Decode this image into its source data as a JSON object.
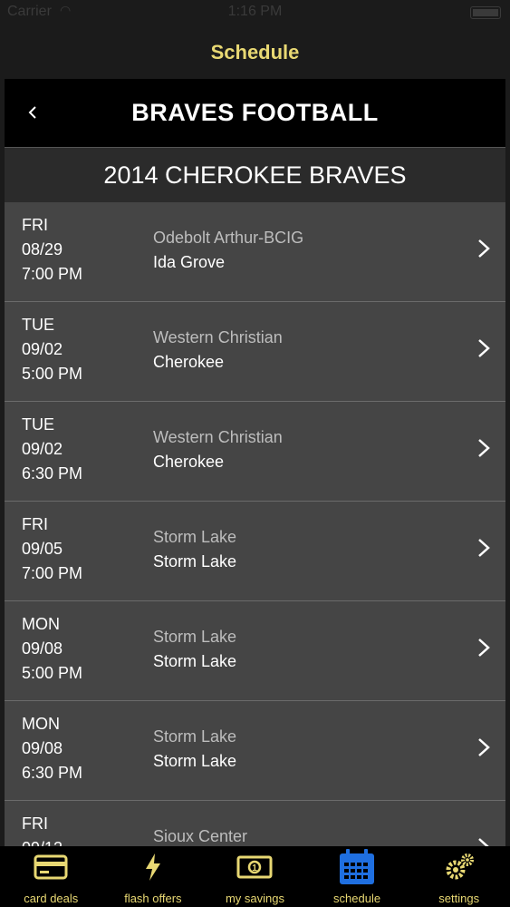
{
  "status_bar": {
    "carrier": "Carrier",
    "time": "1:16 PM"
  },
  "nav": {
    "title": "Schedule"
  },
  "team": {
    "title": "BRAVES FOOTBALL"
  },
  "season": {
    "title": "2014 CHEROKEE BRAVES"
  },
  "games": [
    {
      "day": "FRI",
      "date": "08/29",
      "time": "7:00 PM",
      "opponent": "Odebolt Arthur-BCIG",
      "location": "Ida Grove"
    },
    {
      "day": "TUE",
      "date": "09/02",
      "time": "5:00 PM",
      "opponent": "Western Christian",
      "location": "Cherokee"
    },
    {
      "day": "TUE",
      "date": "09/02",
      "time": "6:30 PM",
      "opponent": "Western Christian",
      "location": "Cherokee"
    },
    {
      "day": "FRI",
      "date": "09/05",
      "time": "7:00 PM",
      "opponent": "Storm Lake",
      "location": "Storm Lake"
    },
    {
      "day": "MON",
      "date": "09/08",
      "time": "5:00 PM",
      "opponent": "Storm Lake",
      "location": "Storm Lake"
    },
    {
      "day": "MON",
      "date": "09/08",
      "time": "6:30 PM",
      "opponent": "Storm Lake",
      "location": "Storm Lake"
    },
    {
      "day": "FRI",
      "date": "09/12",
      "time": "",
      "opponent": "Sioux Center",
      "location": ""
    }
  ],
  "tabs": [
    {
      "label": "card deals",
      "icon": "card-icon"
    },
    {
      "label": "flash offers",
      "icon": "lightning-icon"
    },
    {
      "label": "my savings",
      "icon": "money-icon"
    },
    {
      "label": "schedule",
      "icon": "calendar-icon"
    },
    {
      "label": "settings",
      "icon": "gear-icon"
    }
  ],
  "colors": {
    "accent": "#e8d873",
    "active_tab": "#1f6fe0",
    "background": "#454545"
  }
}
